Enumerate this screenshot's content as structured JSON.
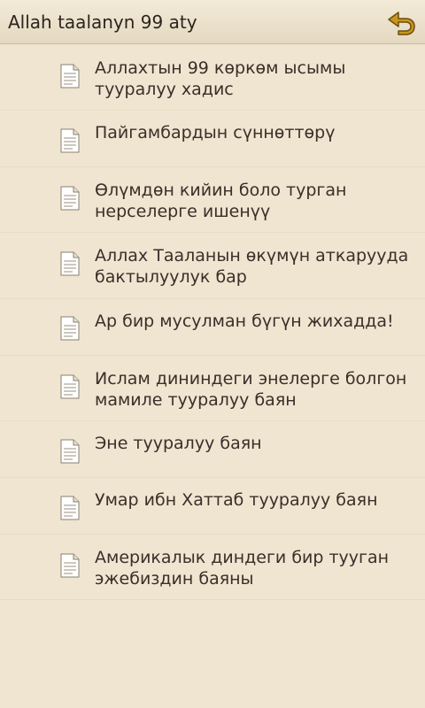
{
  "header": {
    "title": "Allah taalanyn 99 aty",
    "back_icon": "back-arrow-icon"
  },
  "list": {
    "items": [
      {
        "label": "Аллахтын 99 көркөм ысымы тууралуу хадис"
      },
      {
        "label": "Пайгамбардын сүннөттөрү"
      },
      {
        "label": "Өлүмдөн кийин боло турган нерселерге ишенүү"
      },
      {
        "label": "Аллах Тааланын өкүмүн аткарууда бактылуулук бар"
      },
      {
        "label": "Ар бир мусулман бүгүн жихадда!"
      },
      {
        "label": "Ислам дининдеги энелерге болгон мамиле тууралуу баян"
      },
      {
        "label": "Эне тууралуу баян"
      },
      {
        "label": "Умар ибн Хаттаб тууралуу баян"
      },
      {
        "label": "Америкалык диндеги бир тууган эжебиздин баяны"
      }
    ]
  },
  "colors": {
    "background": "#f0e5d0",
    "accent": "#b8860b"
  }
}
